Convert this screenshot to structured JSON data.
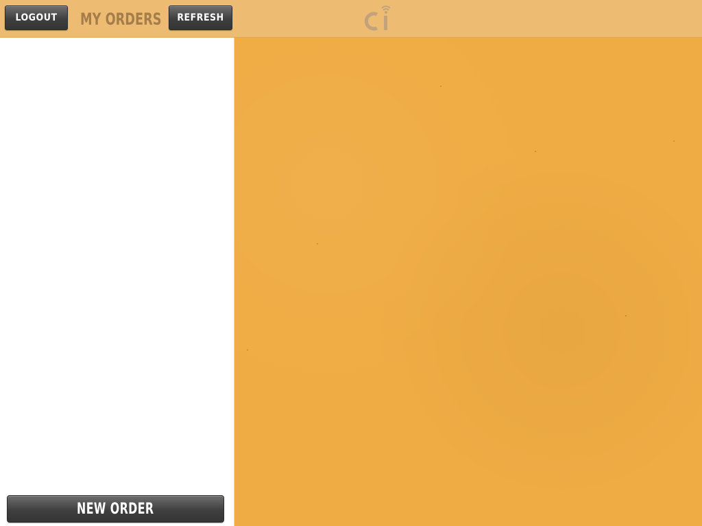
{
  "topbar": {
    "logout_label": "LOGOUT",
    "title": "MY ORDERS",
    "refresh_label": "REFRESH",
    "logo_icon": "ci-logo-icon"
  },
  "left_panel": {
    "new_order_label": "NEW ORDER"
  },
  "colors": {
    "topbar_bg": "#edbc72",
    "content_bg": "#f0ac44",
    "title_text": "#a47d4a",
    "button_dark": "#3f3f3f"
  }
}
